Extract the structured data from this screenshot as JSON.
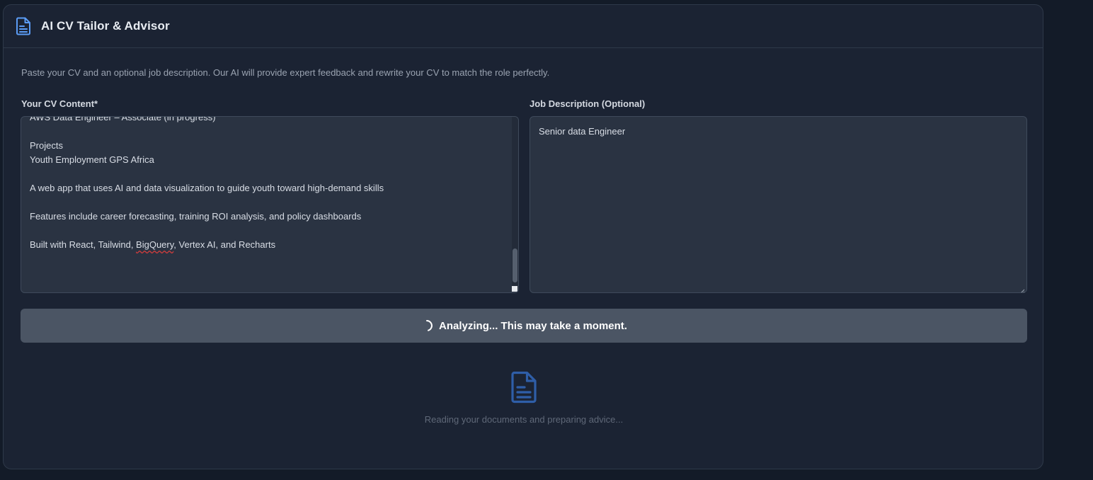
{
  "header": {
    "title": "AI CV Tailor & Advisor",
    "icon": "document-icon"
  },
  "intro": {
    "description": "Paste your CV and an optional job description. Our AI will provide expert feedback and rewrite your CV to match the role perfectly."
  },
  "cv_field": {
    "label": "Your CV Content*",
    "lines": [
      "AWS Data Engineer – Associate (in progress)",
      "",
      "Projects",
      "Youth Employment GPS Africa",
      "",
      "A web app that uses AI and data visualization to guide youth toward high-demand skills",
      "",
      "Features include career forecasting, training ROI analysis, and policy dashboards",
      "",
      "Built with React, Tailwind, ",
      "BigQuery",
      ", Vertex AI, and Recharts"
    ]
  },
  "job_field": {
    "label": "Job Description (Optional)",
    "value": "Senior data Engineer"
  },
  "analyze_button": {
    "label": "Analyzing... This may take a moment."
  },
  "loading": {
    "icon": "document-icon",
    "message": "Reading your documents and preparing advice..."
  },
  "colors": {
    "accent_icon": "#5b9cf5",
    "loading_icon": "#2f5ea8",
    "button_bg": "#4b5564",
    "card_bg": "#1b2333",
    "page_bg": "#131b28"
  }
}
